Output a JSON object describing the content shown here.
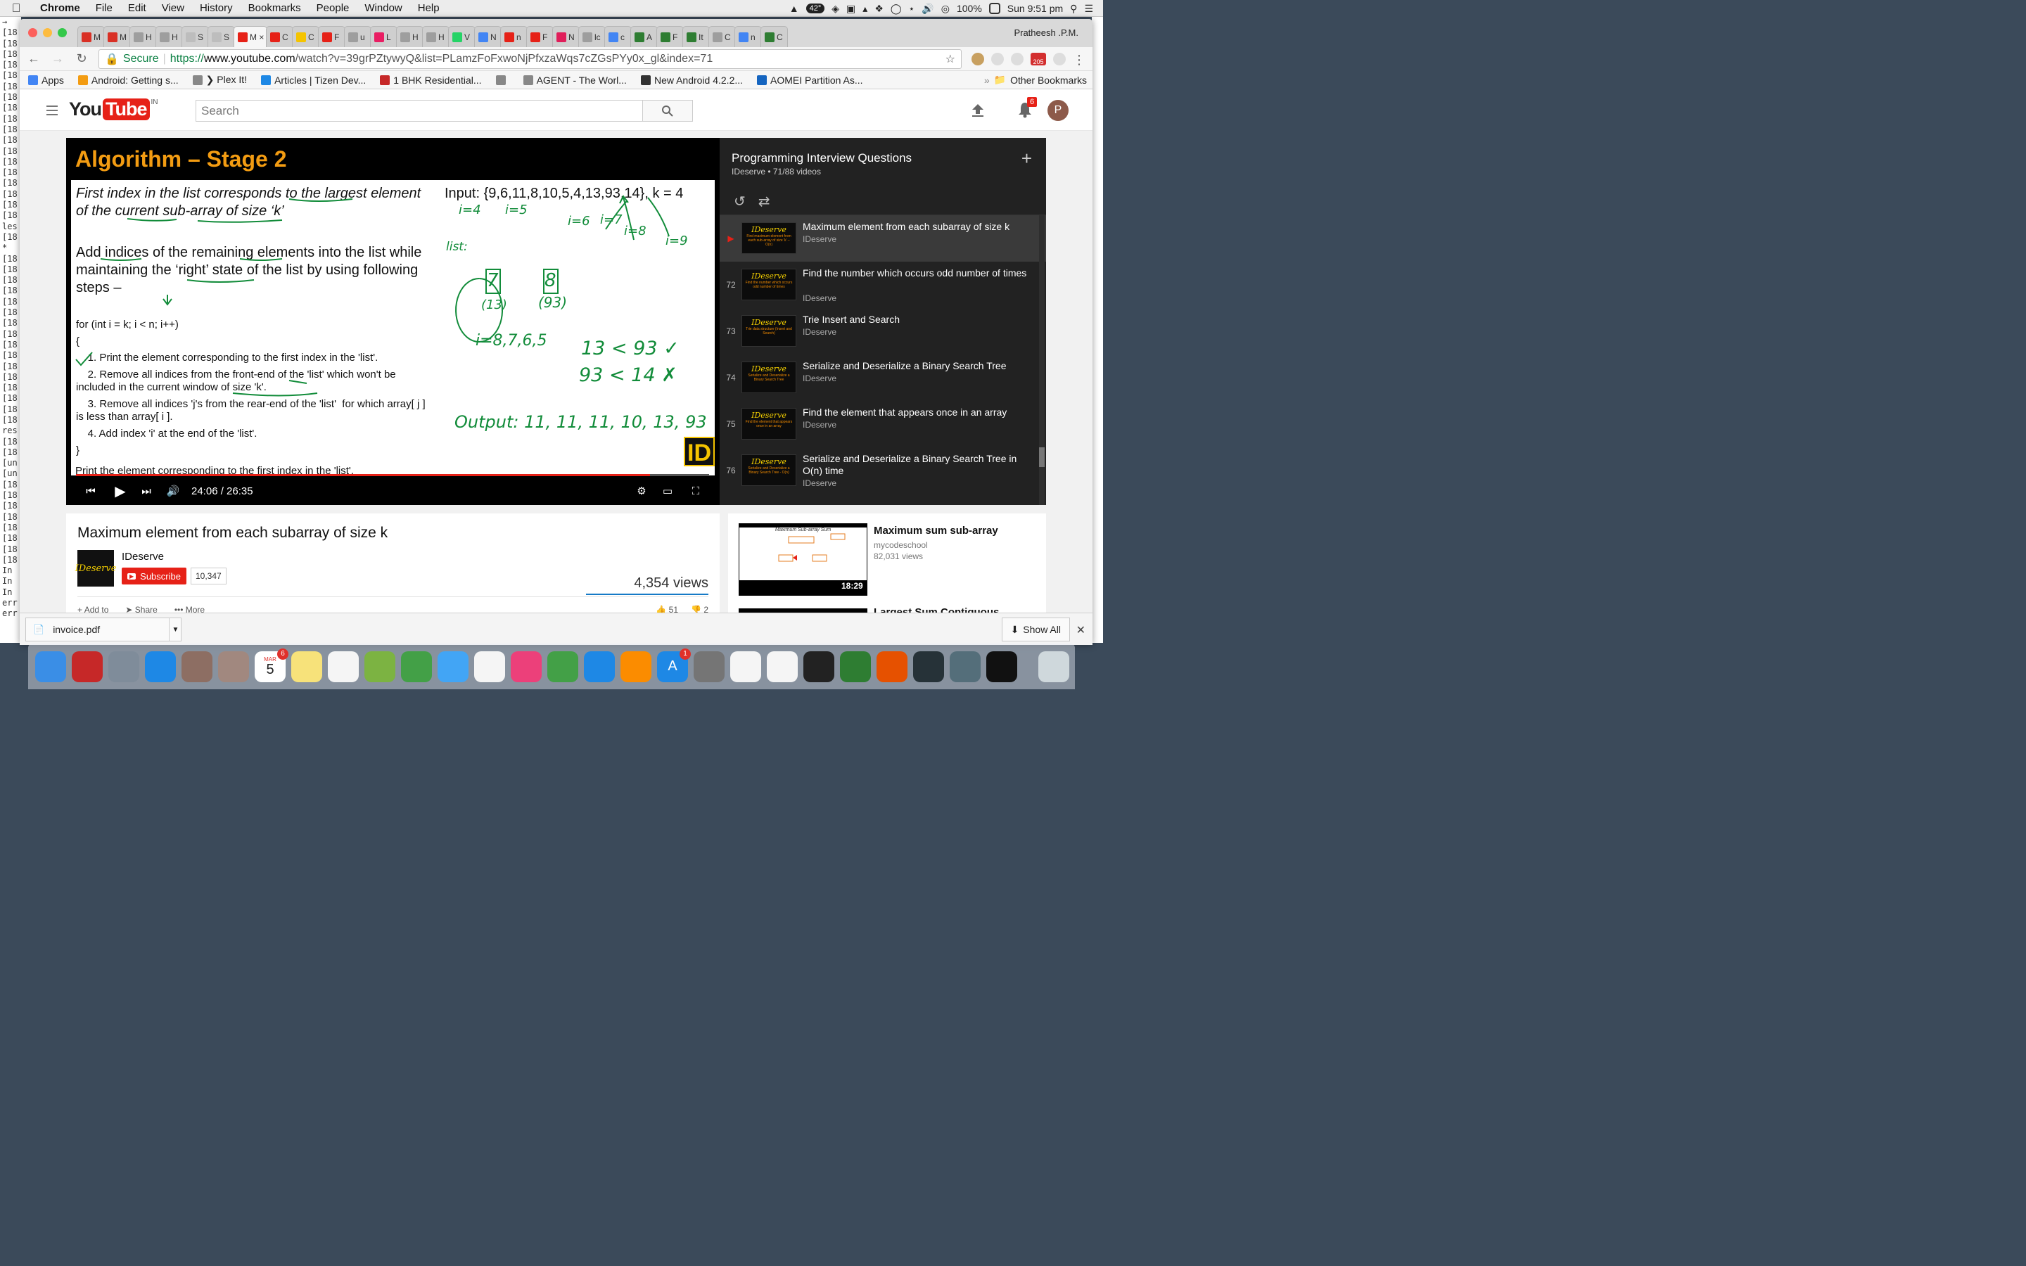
{
  "menubar": {
    "app": "Chrome",
    "items": [
      "File",
      "Edit",
      "View",
      "History",
      "Bookmarks",
      "People",
      "Window",
      "Help"
    ],
    "temperature": "42°",
    "battery": "100%",
    "clock": "Sun 9:51 pm"
  },
  "terminal_lines": [
    "→",
    "[18",
    "[18",
    "[18",
    "[18",
    "[18",
    "[18",
    "[18",
    "[18",
    "[18",
    "[18",
    "[18",
    "[18",
    "[18",
    "[18",
    "[18",
    "[18",
    "[18",
    "[18",
    "les",
    "[18",
    "*",
    "[18",
    "[18",
    "[18",
    "[18",
    "[18",
    "[18",
    "[18",
    "[18",
    "[18",
    "[18",
    "[18",
    "[18",
    "[18",
    "[18",
    "[18",
    "[18",
    "res",
    "[18",
    "[18",
    "[un",
    "[un",
    "[18",
    "[18",
    "[18",
    "[18",
    "[18",
    "[18",
    "[18",
    "[18",
    "In",
    "In",
    "In",
    "err",
    "err"
  ],
  "browser": {
    "profile_name": "Pratheesh .P.M.",
    "tabs": [
      {
        "label": "M I",
        "color": "#d93025"
      },
      {
        "label": "M I",
        "color": "#d93025"
      },
      {
        "label": "H",
        "color": "#9e9e9e"
      },
      {
        "label": "H",
        "color": "#9e9e9e"
      },
      {
        "label": "S",
        "color": "#bdbdbd"
      },
      {
        "label": "S",
        "color": "#bdbdbd"
      },
      {
        "label": "M ×",
        "color": "#e62117"
      },
      {
        "label": "C",
        "color": "#e62117"
      },
      {
        "label": "C",
        "color": "#f5c400"
      },
      {
        "label": "F",
        "color": "#e62117"
      },
      {
        "label": "u",
        "color": "#9e9e9e"
      },
      {
        "label": "L",
        "color": "#e91e63"
      },
      {
        "label": "H",
        "color": "#9e9e9e"
      },
      {
        "label": "H",
        "color": "#9e9e9e"
      },
      {
        "label": "V",
        "color": "#25d366"
      },
      {
        "label": "N",
        "color": "#4285f4"
      },
      {
        "label": "n",
        "color": "#e62117"
      },
      {
        "label": "F",
        "color": "#e62117"
      },
      {
        "label": "N",
        "color": "#e01e5a"
      },
      {
        "label": "lc",
        "color": "#9e9e9e"
      },
      {
        "label": "c",
        "color": "#4285f4"
      },
      {
        "label": "A",
        "color": "#2e7d32"
      },
      {
        "label": "F",
        "color": "#2e7d32"
      },
      {
        "label": "It",
        "color": "#2e7d32"
      },
      {
        "label": "C",
        "color": "#9e9e9e"
      },
      {
        "label": "n",
        "color": "#4285f4"
      },
      {
        "label": "C",
        "color": "#2e7d32"
      }
    ],
    "active_tab_index": 6,
    "secure_label": "Secure",
    "url_scheme": "https://",
    "url_host": "www.youtube.com",
    "url_path": "/watch?v=39grPZtywyQ&list=PLamzFoFxwoNjPfxzaWqs7cZGsPYy0x_gl&index=71",
    "ext_badge": "205",
    "bookmarks": [
      {
        "label": "Apps",
        "icon_color": "#4285f4"
      },
      {
        "label": "Android: Getting s...",
        "icon_color": "#f39c12"
      },
      {
        "label": "❯ Plex It!",
        "icon_color": "#888888"
      },
      {
        "label": "Articles | Tizen Dev...",
        "icon_color": "#1e88e5"
      },
      {
        "label": "1 BHK Residential...",
        "icon_color": "#c62828"
      },
      {
        "label": "",
        "icon_color": "#888888"
      },
      {
        "label": "AGENT - The Worl...",
        "icon_color": "#888888"
      },
      {
        "label": "New Android 4.2.2...",
        "icon_color": "#333333"
      },
      {
        "label": "AOMEI Partition As...",
        "icon_color": "#1565c0"
      }
    ],
    "other_bookmarks": "Other Bookmarks"
  },
  "youtube": {
    "logo_you": "You",
    "logo_tube": "Tube",
    "logo_region": "IN",
    "search_placeholder": "Search",
    "notification_count": "6",
    "avatar_letter": "P",
    "player": {
      "slide_title": "Algorithm – Stage 2",
      "line1": "First index in the list corresponds to the largest element",
      "line2": "of the current sub-array of size ‘k’",
      "input_text": "Input: {9,6,11,8,10,5,4,13,93,14},  k = 4",
      "add1": "Add indices of the remaining elements into the list while",
      "add2": "maintaining the ‘right’ state of the list by using following",
      "add3": "steps –",
      "code": [
        "for (int i = k; i < n; i++)",
        "{",
        "    1. Print the element corresponding to the first index in the 'list'.",
        "    2. Remove all indices from the front-end of the 'list' which won't be",
        "included in the current window of size 'k'.",
        "    3. Remove all indices 'j's from the rear-end of the 'list'  for which array[ j ]",
        "is less than array[ i ].",
        "    4. Add index 'i' at the end of the 'list'.",
        "}"
      ],
      "caption": "Print the element corresponding to the first index in the 'list'.",
      "handwriting": {
        "i4": "i=4",
        "i5": "i=5",
        "i6": "i=6",
        "i7": "i=7",
        "i8": "i=8",
        "i9": "i=9",
        "list": "list:",
        "box7": "7",
        "box7_sub": "(13)",
        "box8": "8",
        "box8_sub": "(93)",
        "iseq": "i=8,7,6,5",
        "cmp1": "13 < 93 ✓",
        "cmp2": "93 < 14 ✗",
        "output": "Output: 11, 11, 11, 10, 13, 93"
      },
      "id_logo": "ID",
      "time": "24:06 / 26:35",
      "progress": 0.907
    },
    "playlist": {
      "title": "Programming Interview Questions",
      "meta": "IDeserve • 71/88 videos",
      "items": [
        {
          "num": "▶",
          "title": "Maximum element from each subarray of size k",
          "channel": "IDeserve",
          "thumb_sub": "Find maximum element from each sub-array of size 'k' – O(n)",
          "active": true
        },
        {
          "num": "72",
          "title": "Find the number which occurs odd number of times",
          "channel": "IDeserve",
          "thumb_sub": "Find the number which occurs odd number of times",
          "active": false
        },
        {
          "num": "73",
          "title": "Trie Insert and Search",
          "channel": "IDeserve",
          "thumb_sub": "Trie data structure (Insert and Search)",
          "active": false
        },
        {
          "num": "74",
          "title": "Serialize and Deserialize a Binary Search Tree",
          "channel": "IDeserve",
          "thumb_sub": "Serialize and Deserialize a Binary Search Tree",
          "active": false
        },
        {
          "num": "75",
          "title": "Find the element that appears once in an array",
          "channel": "IDeserve",
          "thumb_sub": "Find the element that appears once in an array",
          "active": false
        },
        {
          "num": "76",
          "title": "Serialize and Deserialize a Binary Search Tree in O(n) time",
          "channel": "IDeserve",
          "thumb_sub": "Serialize and Deserialize a Binary Search Tree - O(n)",
          "active": false
        }
      ],
      "brand": "IDeserve"
    },
    "video": {
      "title": "Maximum element from each subarray of size k",
      "channel": "IDeserve",
      "subscribe": "Subscribe",
      "subscriber_count": "10,347",
      "views": "4,354 views",
      "actions": [
        "Add to",
        "Share",
        "More"
      ],
      "likes": "51",
      "dislikes": "2"
    },
    "related": {
      "title": "Maximum sum sub-array",
      "channel": "mycodeschool",
      "views": "82,031 views",
      "duration": "18:29",
      "thumb_caption": "Maximum Sub-array Sum",
      "next_title": "Largest Sum Contiguous"
    }
  },
  "download_shelf": {
    "file": "invoice.pdf",
    "show_all": "Show All"
  },
  "dock": {
    "calendar_month": "MAR",
    "calendar_day": "5",
    "calendar_badge": "6",
    "appstore_badge": "1",
    "apps": [
      {
        "name": "finder",
        "color": "#3a8ee6"
      },
      {
        "name": "antivirus",
        "color": "#c62828"
      },
      {
        "name": "launchpad",
        "color": "#7f8c9a"
      },
      {
        "name": "safari",
        "color": "#1e88e5"
      },
      {
        "name": "preview",
        "color": "#8d6e63"
      },
      {
        "name": "contacts",
        "color": "#a1887f"
      },
      {
        "name": "calendar",
        "color": "#ffffff"
      },
      {
        "name": "notes",
        "color": "#f7e27a"
      },
      {
        "name": "reminders",
        "color": "#f5f5f5"
      },
      {
        "name": "maps",
        "color": "#7cb342"
      },
      {
        "name": "facetime",
        "color": "#43a047"
      },
      {
        "name": "messages",
        "color": "#42a5f5"
      },
      {
        "name": "photos",
        "color": "#f5f5f5"
      },
      {
        "name": "itunes",
        "color": "#ec407a"
      },
      {
        "name": "numbers",
        "color": "#43a047"
      },
      {
        "name": "keynote",
        "color": "#1e88e5"
      },
      {
        "name": "ibooks",
        "color": "#fb8c00"
      },
      {
        "name": "appstore",
        "color": "#1e88e5"
      },
      {
        "name": "system-preferences",
        "color": "#757575"
      },
      {
        "name": "chrome",
        "color": "#f5f5f5"
      },
      {
        "name": "textedit",
        "color": "#f5f5f5"
      },
      {
        "name": "terminal",
        "color": "#222222"
      },
      {
        "name": "evernote",
        "color": "#2e7d32"
      },
      {
        "name": "instruments",
        "color": "#e65100"
      },
      {
        "name": "activity-monitor",
        "color": "#263238"
      },
      {
        "name": "sublime",
        "color": "#546e7a"
      },
      {
        "name": "intellij",
        "color": "#111111"
      },
      {
        "name": "trash",
        "color": "#cfd8dc"
      }
    ]
  }
}
